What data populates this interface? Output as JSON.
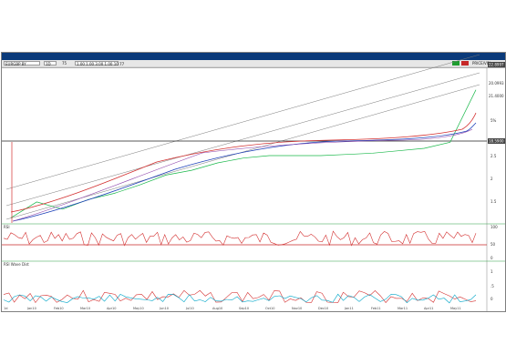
{
  "toolbar": {
    "symbol": "EURGBP BY",
    "interval": "1D",
    "field_a": "75",
    "field_b": "1.00 1.00 3.00 1.00 10.77",
    "mode": "PRICE/VOL",
    "colors": {
      "title": "#0a3a7a",
      "btn_green": "#1e9d2f",
      "btn_red": "#c62828"
    }
  },
  "price_scale": {
    "tag_top": "22.8997",
    "tag_mid": "20.0993",
    "tag_low": "21.4000",
    "lbl_a": "5%",
    "lbl_b": "2.5",
    "lbl_c": "2",
    "lbl_d": "1.5",
    "tag_line": "18.5900"
  },
  "rsi_pane": {
    "label": "RSI",
    "scale_hi": "100",
    "scale_mid": "50",
    "scale_lo": "0"
  },
  "macd_pane": {
    "label": "RSI Wave Dist",
    "scale_hi": "1",
    "scale_mid": ".5",
    "scale_lo": "0"
  },
  "x_axis": {
    "labels": [
      "Jan10",
      "Feb10",
      "Mar10",
      "Apr10",
      "May10",
      "Jun10",
      "Jul10",
      "Aug10",
      "Sep10",
      "Oct10",
      "Nov10",
      "Dec10",
      "Jan11",
      "Feb11",
      "Mar11",
      "Apr11",
      "May11"
    ],
    "corner": "1d"
  },
  "chart_data": {
    "type": "line",
    "series": [
      {
        "name": "",
        "values": [
          1.35,
          1.48,
          1.42,
          1.5,
          1.55,
          1.62,
          1.7,
          1.74,
          1.8,
          1.84,
          1.86,
          1.86,
          1.86,
          1.87,
          1.88,
          1.9,
          1.92,
          1.97,
          2.4
        ]
      }
    ]
  }
}
